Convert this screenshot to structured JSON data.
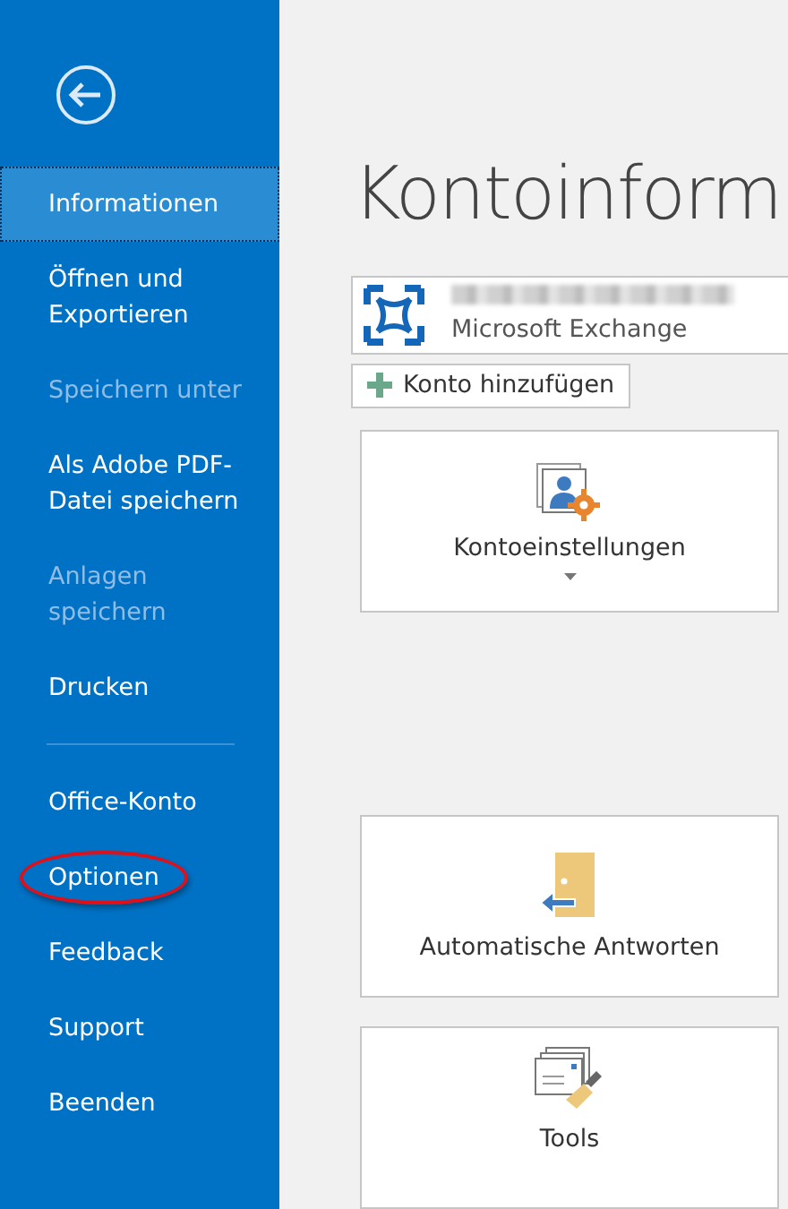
{
  "sidebar": {
    "items": [
      {
        "label": "Informationen",
        "selected": true,
        "disabled": false,
        "highlighted": false
      },
      {
        "label": "Öffnen und Exportieren",
        "selected": false,
        "disabled": false,
        "highlighted": false
      },
      {
        "label": "Speichern unter",
        "selected": false,
        "disabled": true,
        "highlighted": false
      },
      {
        "label": "Als Adobe PDF-Datei speichern",
        "selected": false,
        "disabled": false,
        "highlighted": false
      },
      {
        "label": "Anlagen speichern",
        "selected": false,
        "disabled": true,
        "highlighted": false
      },
      {
        "label": "Drucken",
        "selected": false,
        "disabled": false,
        "highlighted": false
      },
      {
        "kind": "divider"
      },
      {
        "label": "Office-Konto",
        "selected": false,
        "disabled": false,
        "highlighted": false
      },
      {
        "label": "Optionen",
        "selected": false,
        "disabled": false,
        "highlighted": true
      },
      {
        "label": "Feedback",
        "selected": false,
        "disabled": false,
        "highlighted": false
      },
      {
        "label": "Support",
        "selected": false,
        "disabled": false,
        "highlighted": false
      },
      {
        "label": "Beenden",
        "selected": false,
        "disabled": false,
        "highlighted": false
      }
    ]
  },
  "main": {
    "title": "Kontoinform",
    "account": {
      "type": "Microsoft Exchange"
    },
    "add_account_button": "Konto hinzufügen",
    "cards": [
      {
        "kind": "settings",
        "label": "Kontoeinstellungen",
        "dropdown": true
      },
      {
        "kind": "autoreply",
        "label": "Automatische Antworten",
        "dropdown": false
      },
      {
        "kind": "tools",
        "label": "Tools",
        "dropdown": false
      }
    ]
  }
}
